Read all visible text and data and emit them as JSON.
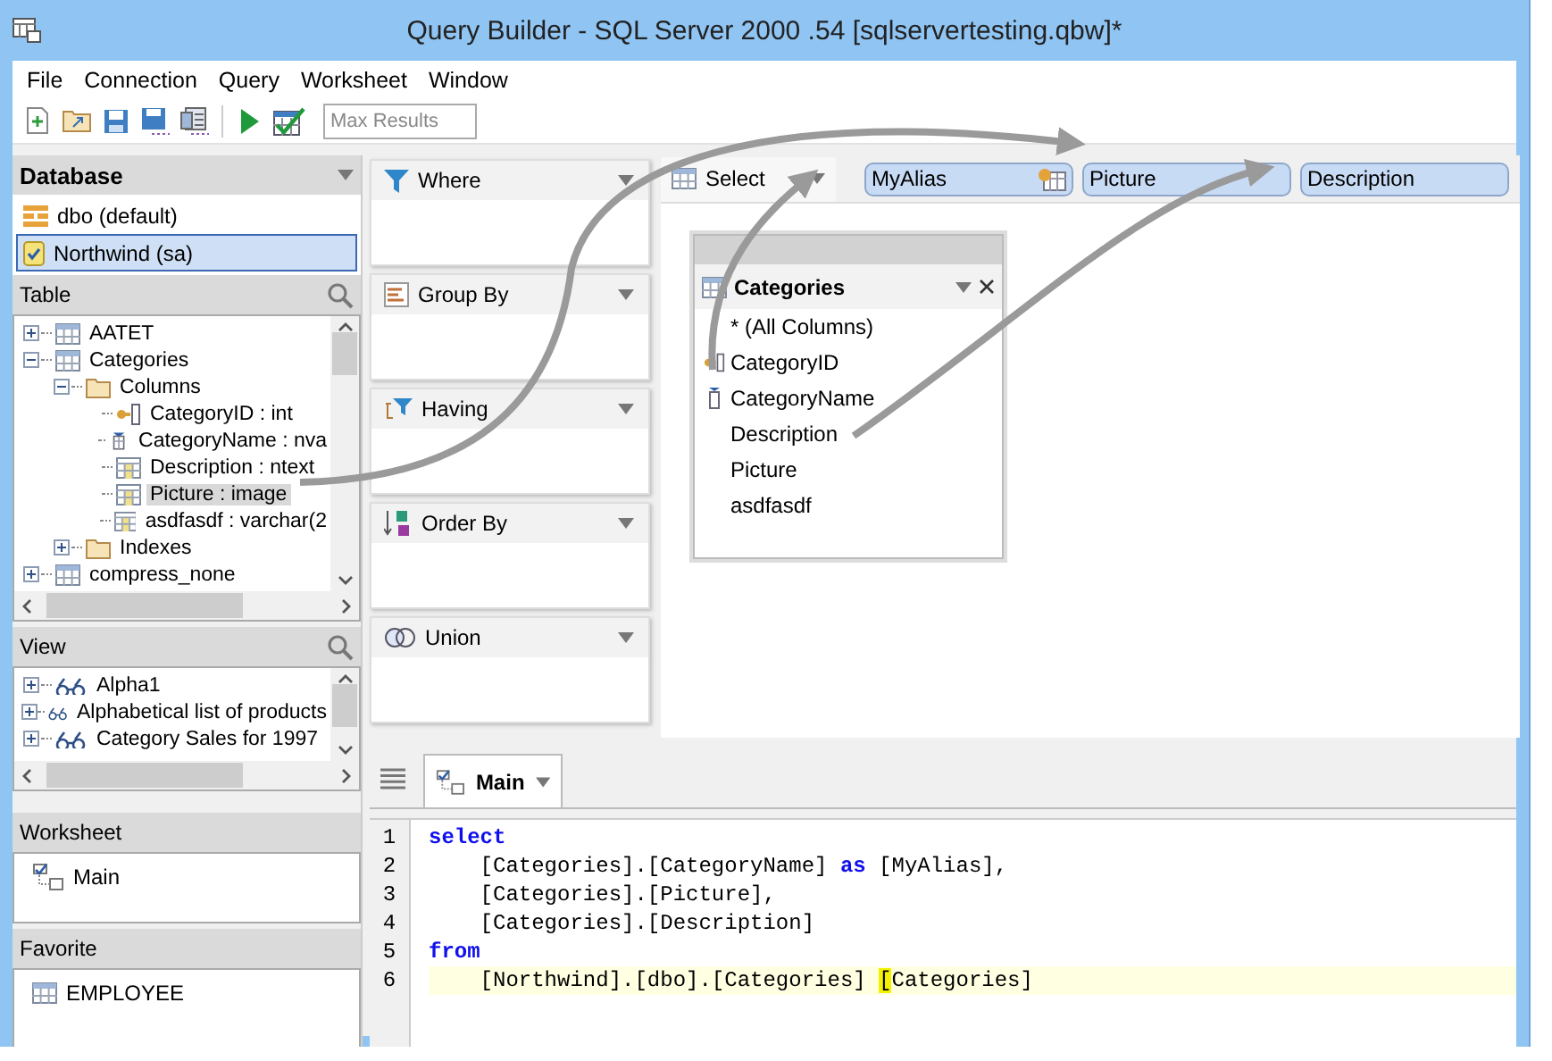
{
  "window": {
    "title": "Query Builder - SQL Server 2000 .54 [sqlservertesting.qbw]*"
  },
  "menu": [
    "File",
    "Connection",
    "Query",
    "Worksheet",
    "Window"
  ],
  "toolbar": {
    "buttons": [
      {
        "kind": "new"
      },
      {
        "kind": "open"
      },
      {
        "kind": "save"
      },
      {
        "kind": "save-all"
      },
      {
        "kind": "properties"
      },
      {
        "kind": "separator"
      },
      {
        "kind": "run"
      },
      {
        "kind": "check"
      }
    ],
    "max_results": {
      "placeholder": "Max Results"
    }
  },
  "database": {
    "title": "Database",
    "items": [
      {
        "label": "dbo (default)",
        "kind": "schema",
        "selected": false
      },
      {
        "label": "Northwind (sa)",
        "kind": "connection",
        "selected": true
      }
    ]
  },
  "table": {
    "title": "Table",
    "tree": [
      {
        "label": "AATET",
        "kind": "table",
        "expanded": false,
        "selected": false
      },
      {
        "label": "Categories",
        "kind": "table",
        "expanded": true,
        "selected": false,
        "children": [
          {
            "label": "Columns",
            "kind": "folder",
            "expanded": true,
            "selected": false,
            "children": [
              {
                "label": "CategoryID : int",
                "kind": "key",
                "selected": false
              },
              {
                "label": "CategoryName : nva",
                "kind": "indexed",
                "selected": false
              },
              {
                "label": "Description : ntext",
                "kind": "column",
                "selected": false
              },
              {
                "label": "Picture : image",
                "kind": "column",
                "selected": true
              },
              {
                "label": "asdfasdf : varchar(2",
                "kind": "column",
                "selected": false
              }
            ]
          },
          {
            "label": "Indexes",
            "kind": "folder",
            "expanded": false,
            "selected": false
          }
        ]
      },
      {
        "label": "compress_none",
        "kind": "table",
        "expanded": false,
        "selected": false
      }
    ]
  },
  "view": {
    "title": "View",
    "tree": [
      {
        "label": "Alpha1",
        "kind": "view",
        "expanded": false,
        "selected": false
      },
      {
        "label": "Alphabetical list of products",
        "kind": "view",
        "expanded": false,
        "selected": false
      },
      {
        "label": "Category Sales for 1997",
        "kind": "view",
        "expanded": false,
        "selected": false
      }
    ]
  },
  "worksheet": {
    "title": "Worksheet",
    "items": [
      {
        "label": "Main",
        "kind": "worksheet"
      }
    ]
  },
  "favorite": {
    "title": "Favorite",
    "items": [
      {
        "label": "EMPLOYEE",
        "kind": "table"
      }
    ]
  },
  "clauses": [
    {
      "label": "Where",
      "kind": "where"
    },
    {
      "label": "Group By",
      "kind": "group"
    },
    {
      "label": "Having",
      "kind": "having"
    },
    {
      "label": "Order By",
      "kind": "order"
    },
    {
      "label": "Union",
      "kind": "union"
    }
  ],
  "select_bar": {
    "label": "Select",
    "fields": [
      {
        "label": "MyAlias",
        "kind": "alias"
      },
      {
        "label": "Picture",
        "kind": "column"
      },
      {
        "label": "Description",
        "kind": "column"
      }
    ]
  },
  "table_card": {
    "title": "Categories",
    "columns": [
      {
        "label": "* (All Columns)",
        "kind": "all"
      },
      {
        "label": "CategoryID",
        "kind": "key"
      },
      {
        "label": "CategoryName",
        "kind": "indexed"
      },
      {
        "label": "Description",
        "kind": "plain"
      },
      {
        "label": "Picture",
        "kind": "plain"
      },
      {
        "label": "asdfasdf",
        "kind": "plain"
      }
    ]
  },
  "editor": {
    "tab": {
      "label": "Main"
    },
    "lines": [
      {
        "number": "1",
        "current": false,
        "tokens": [
          {
            "text": "select",
            "kind": "keyword"
          }
        ]
      },
      {
        "number": "2",
        "current": false,
        "tokens": [
          {
            "text": "    [Categories].[CategoryName] ",
            "kind": "plain"
          },
          {
            "text": "as",
            "kind": "keyword"
          },
          {
            "text": " [MyAlias],",
            "kind": "plain"
          }
        ]
      },
      {
        "number": "3",
        "current": false,
        "tokens": [
          {
            "text": "    [Categories].[Picture],",
            "kind": "plain"
          }
        ]
      },
      {
        "number": "4",
        "current": false,
        "tokens": [
          {
            "text": "    [Categories].[Description]",
            "kind": "plain"
          }
        ]
      },
      {
        "number": "5",
        "current": false,
        "tokens": [
          {
            "text": "from",
            "kind": "keyword"
          }
        ]
      },
      {
        "number": "6",
        "current": true,
        "tokens": [
          {
            "text": "    [Northwind].[dbo].[Categories] ",
            "kind": "plain"
          },
          {
            "text": "[",
            "kind": "match"
          },
          {
            "text": "Categories]",
            "kind": "plain"
          }
        ]
      }
    ]
  }
}
